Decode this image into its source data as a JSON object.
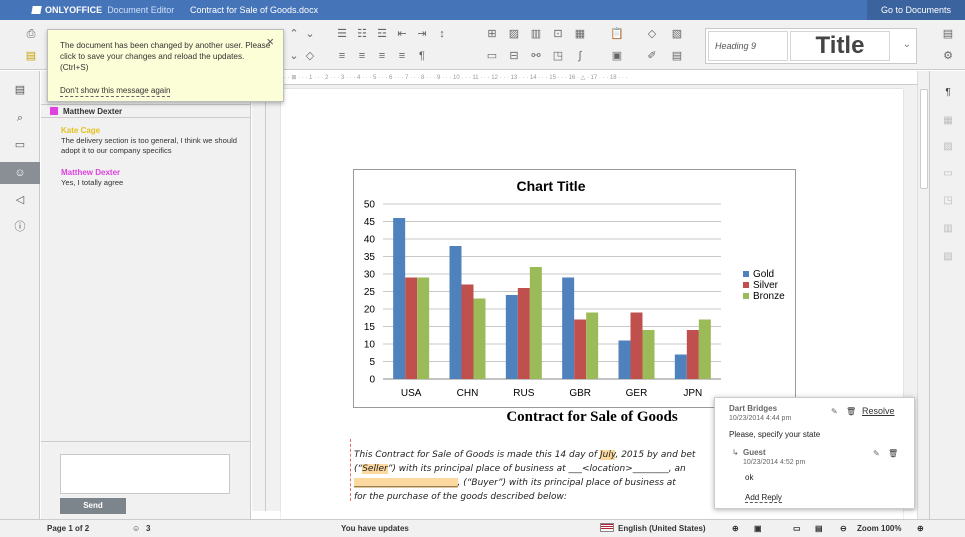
{
  "titlebar": {
    "brand": "ONLYOFFICE",
    "editor": "Document Editor",
    "doc_title": "Contract for Sale of Goods.docx",
    "goto": "Go to Documents"
  },
  "notice": {
    "message": "The document has been changed by another user. Please click to save your changes and reload the updates. (Ctrl+S)",
    "dont_show": "Don't show this message again"
  },
  "styles": {
    "heading9": "Heading 9",
    "title": "Title"
  },
  "comments": {
    "header_author": "Matthew Dexter",
    "items": [
      {
        "author": "Kate Cage",
        "author_color": "#e3c120",
        "text": "The delivery section is too general, I think we should adopt it to our company specifics"
      },
      {
        "author": "Matthew Dexter",
        "author_color": "#e040e0",
        "text": "Yes, I totally agree"
      }
    ],
    "send": "Send"
  },
  "chart_data": {
    "type": "bar",
    "title": "Chart Title",
    "categories": [
      "USA",
      "CHN",
      "RUS",
      "GBR",
      "GER",
      "JPN"
    ],
    "series": [
      {
        "name": "Gold",
        "color": "#4f81bd",
        "values": [
          46,
          38,
          24,
          29,
          11,
          7
        ]
      },
      {
        "name": "Silver",
        "color": "#c0504d",
        "values": [
          29,
          27,
          26,
          17,
          19,
          14
        ]
      },
      {
        "name": "Bronze",
        "color": "#9bbb59",
        "values": [
          29,
          23,
          32,
          19,
          14,
          17
        ]
      }
    ],
    "ylim": [
      0,
      50
    ],
    "yticks": [
      0,
      5,
      10,
      15,
      20,
      25,
      30,
      35,
      40,
      45,
      50
    ],
    "legend": "right"
  },
  "document": {
    "heading": "Contract for Sale of Goods",
    "line1_a": "This Contract for Sale of Goods is made this 14 day of ",
    "line1_hl": "July",
    "line1_b": ", 2015 by and bet",
    "line2_a": "(“",
    "line2_hl": "Seller",
    "line2_b": "”) with its principal place of business at ___<location>________, an",
    "line3_hl": "_______________________",
    "line3_b": ", (“Buyer”) with its principal place of business at",
    "line4": "for the purchase of the goods described below:"
  },
  "popup": {
    "author": "Dart Bridges",
    "date": "10/23/2014 4:44 pm",
    "resolve": "Resolve",
    "text": "Please, specify your state",
    "reply_author": "Guest",
    "reply_date": "10/23/2014 4:52 pm",
    "reply_text": "ok",
    "add_reply": "Add Reply"
  },
  "status": {
    "page": "Page 1 of 2",
    "users": "3",
    "updates": "You have updates",
    "language": "English (United States)",
    "zoom": "Zoom 100%"
  }
}
